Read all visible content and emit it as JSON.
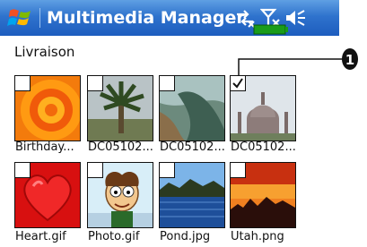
{
  "titlebar": {
    "title": "Multimedia Manager",
    "accent": "#2f73cd"
  },
  "folder": {
    "label": "Livraison"
  },
  "callout": {
    "number": "1"
  },
  "thumbnails": [
    {
      "caption": "Birthday...",
      "checked": false
    },
    {
      "caption": "DC05102...",
      "checked": false
    },
    {
      "caption": "DC05102...",
      "checked": false
    },
    {
      "caption": "DC05102...",
      "checked": true
    },
    {
      "caption": "Heart.gif",
      "checked": false
    },
    {
      "caption": "Photo.gif",
      "checked": false
    },
    {
      "caption": "Pond.jpg",
      "checked": false
    },
    {
      "caption": "Utah.png",
      "checked": false
    }
  ],
  "icons": {
    "start": "windows-flag-icon",
    "connectivity": "sync-arrows-icon",
    "signal": "no-signal-icon",
    "volume": "speaker-muted-icon",
    "battery": "battery-icon"
  }
}
